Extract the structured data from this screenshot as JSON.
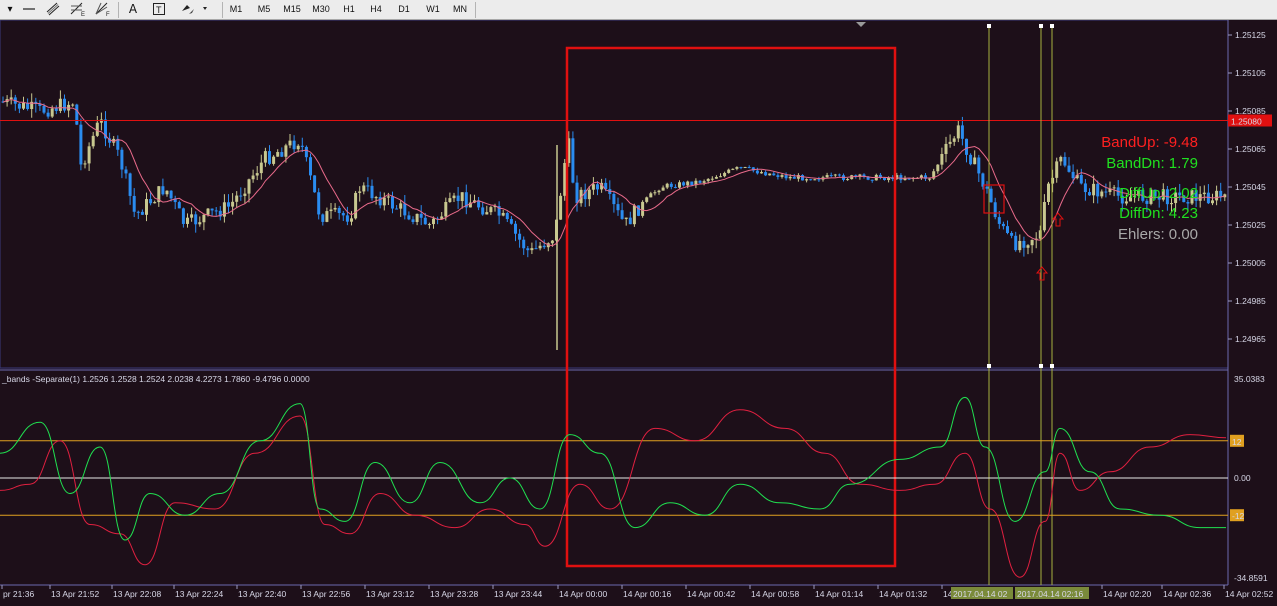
{
  "toolbar": {
    "icons": [
      "line-icon",
      "channel-icon",
      "fibonacci-icon",
      "gann-icon",
      "text-icon",
      "text-label-icon",
      "arrows-icon"
    ],
    "text_tool": "A",
    "timeframes": [
      "M1",
      "M5",
      "M15",
      "M30",
      "H1",
      "H4",
      "D1",
      "W1",
      "MN"
    ]
  },
  "price_axis": {
    "labels": [
      "1.25125",
      "1.25105",
      "1.25085",
      "1.25065",
      "1.25045",
      "1.25025",
      "1.25005",
      "1.24985",
      "1.24965"
    ],
    "current_price": "1.25080",
    "current_price_color": "#e01010"
  },
  "indicator": {
    "header": "_bands -Separate(1) 1.2526 1.2528 1.2524 2.0238 4.2273 1.7860 -9.4796 0.0000",
    "axis_labels": [
      "35.0383",
      "0.00",
      "-34.8591"
    ],
    "level_labels": [
      "12",
      "-12"
    ],
    "level_color": "#e0a020"
  },
  "time_axis": {
    "labels": [
      "pr 21:36",
      "13 Apr 21:52",
      "13 Apr 22:08",
      "13 Apr 22:24",
      "13 Apr 22:40",
      "13 Apr 22:56",
      "13 Apr 23:12",
      "13 Apr 23:28",
      "13 Apr 23:44",
      "14 Apr 00:00",
      "14 Apr 00:16",
      "14 Apr 00:42",
      "14 Apr 00:58",
      "14 Apr 01:14",
      "14 Apr 01:32",
      "14",
      "14 Apr 02:20",
      "14 Apr 02:36",
      "14 Apr 02:52"
    ],
    "highlights": [
      "2017.04.14 02",
      "2017.04.14 02:16"
    ]
  },
  "info": {
    "band_up": "BandUp: -9.48",
    "band_dn": "BandDn: 1.79",
    "diff_up": "DiffUp: 2.02",
    "diff_dn": "DiffDn: 4.23",
    "ehlers": "Ehlers:  0.00",
    "colors": {
      "band_up": "#ff2020",
      "band_dn": "#20e020",
      "diff_up": "#20e020",
      "diff_dn": "#20e020",
      "ehlers": "#a8a8a8"
    }
  },
  "colors": {
    "background": "#1d0f19",
    "bull": "#c8c890",
    "bear": "#2a8cf0",
    "ma": "#e86a8a",
    "osc_green": "#20e050",
    "osc_red": "#e02040",
    "annotation": "#e01010",
    "vlines": "#a8b040"
  }
}
